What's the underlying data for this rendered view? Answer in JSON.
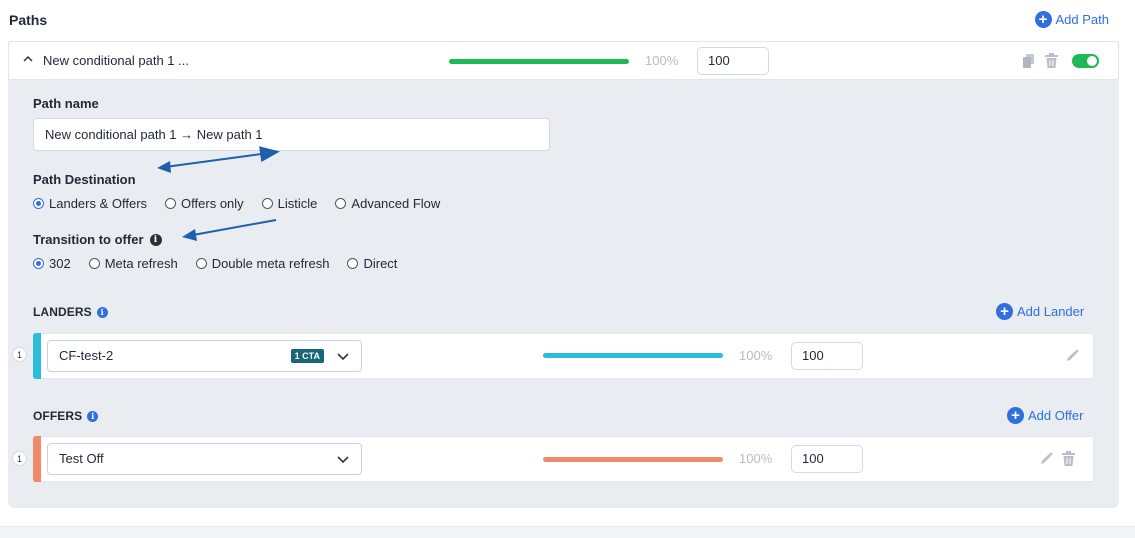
{
  "header": {
    "title": "Paths",
    "add_path_label": "Add Path"
  },
  "path": {
    "title": "New conditional path 1 ...",
    "percent": "100%",
    "weight": "100",
    "weight_fraction": 1.0,
    "enabled": true,
    "colors": {
      "bar": "#1db954",
      "toggle": "#1db954"
    }
  },
  "form": {
    "path_name_label": "Path name",
    "path_name_value": "New conditional path 1 → New path 1",
    "destination_label": "Path Destination",
    "destination_options": [
      "Landers & Offers",
      "Offers only",
      "Listicle",
      "Advanced Flow"
    ],
    "destination_selected": "Landers & Offers",
    "transition_label": "Transition to offer",
    "transition_options": [
      "302",
      "Meta refresh",
      "Double meta refresh",
      "Direct"
    ],
    "transition_selected": "302"
  },
  "landers": {
    "section_label": "LANDERS",
    "add_label": "Add Lander",
    "items": [
      {
        "index": "1",
        "name": "CF-test-2",
        "badge": "1 CTA",
        "percent": "100%",
        "weight": "100",
        "weight_fraction": 1.0,
        "color": "#2bbcd9"
      }
    ]
  },
  "offers": {
    "section_label": "OFFERS",
    "add_label": "Add Offer",
    "items": [
      {
        "index": "1",
        "name": "Test Off",
        "percent": "100%",
        "weight": "100",
        "weight_fraction": 1.0,
        "color": "#f08a6a"
      }
    ]
  },
  "icons": [
    "plus-circle-icon",
    "chevron-up-icon",
    "copy-icon",
    "trash-icon",
    "info-icon",
    "chevron-down-icon",
    "pencil-icon",
    "arrow-annotation-icon"
  ]
}
